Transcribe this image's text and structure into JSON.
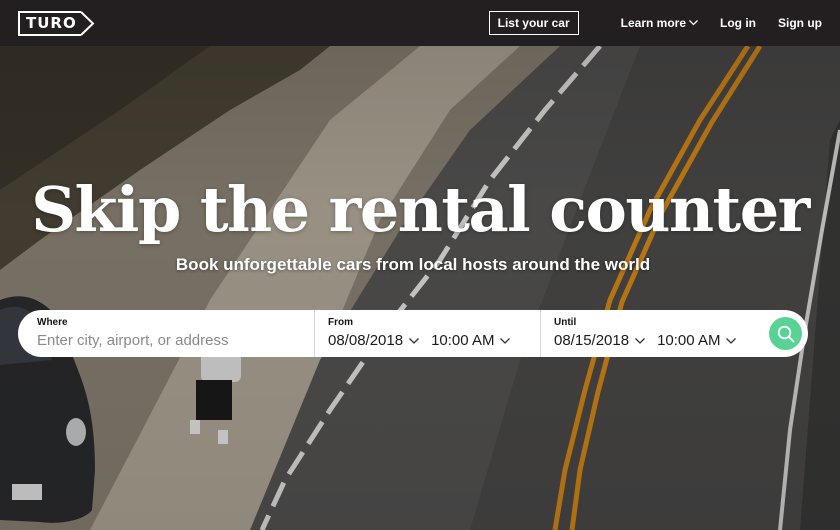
{
  "nav": {
    "logo_text": "TURO",
    "list_car_label": "List your car",
    "learn_more_label": "Learn more",
    "login_label": "Log in",
    "signup_label": "Sign up"
  },
  "hero": {
    "headline": "Skip the rental counter",
    "subheadline": "Book unforgettable cars from local hosts around the world"
  },
  "search": {
    "where_label": "Where",
    "where_placeholder": "Enter city, airport, or address",
    "from_label": "From",
    "from_date": "08/08/2018",
    "from_time": "10:00 AM",
    "until_label": "Until",
    "until_date": "08/15/2018",
    "until_time": "10:00 AM",
    "button_icon": "search-icon",
    "button_color": "#59d393"
  },
  "colors": {
    "nav_bg": "#231f20",
    "accent": "#59d393",
    "road_line_yellow": "#d88a17"
  }
}
